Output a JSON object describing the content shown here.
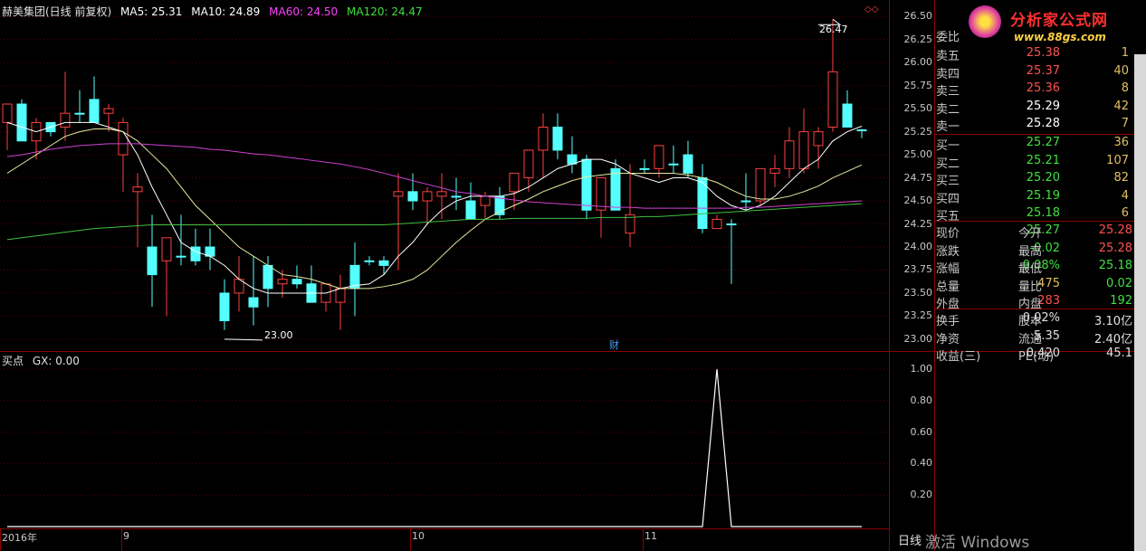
{
  "header": {
    "stock": "赫美集团(日线 前复权)",
    "ma5": "MA5: 25.31",
    "ma10": "MA10: 24.89",
    "ma60": "MA60: 24.50",
    "ma120": "MA120: 24.47"
  },
  "indicator": {
    "title": "买点",
    "gx": "GX: 0.00"
  },
  "logo": {
    "name": "分析家公式网",
    "url": "www.88gs.com"
  },
  "annotations": {
    "high": "26.47",
    "low": "23.00",
    "cai": "财"
  },
  "price_axis": [
    "26.50",
    "26.25",
    "26.00",
    "25.75",
    "25.50",
    "25.25",
    "25.00",
    "24.75",
    "24.50",
    "24.25",
    "24.00",
    "23.75",
    "23.50",
    "23.25",
    "23.00"
  ],
  "indicator_axis": [
    "1.00",
    "0.80",
    "0.60",
    "0.40",
    "0.20"
  ],
  "time_axis": [
    "2016年",
    "9",
    "10",
    "11"
  ],
  "bottom_right": {
    "period": "日线",
    "watermark": "激活 Windows"
  },
  "quote": {
    "weibi": "委比",
    "sells": [
      {
        "label": "卖五",
        "price": "25.38",
        "vol": "1"
      },
      {
        "label": "卖四",
        "price": "25.37",
        "vol": "40"
      },
      {
        "label": "卖三",
        "price": "25.36",
        "vol": "8"
      },
      {
        "label": "卖二",
        "price": "25.29",
        "vol": "42"
      },
      {
        "label": "卖一",
        "price": "25.28",
        "vol": "7"
      }
    ],
    "buys": [
      {
        "label": "买一",
        "price": "25.27",
        "vol": "36"
      },
      {
        "label": "买二",
        "price": "25.21",
        "vol": "107"
      },
      {
        "label": "买三",
        "price": "25.20",
        "vol": "82"
      },
      {
        "label": "买四",
        "price": "25.19",
        "vol": "4"
      },
      {
        "label": "买五",
        "price": "25.18",
        "vol": "6"
      }
    ],
    "stats": [
      {
        "l1": "现价",
        "v1": "25.27",
        "l2": "今开",
        "v2": "25.28"
      },
      {
        "l1": "涨跌",
        "v1": "-0.02",
        "l2": "最高",
        "v2": "25.28"
      },
      {
        "l1": "涨幅",
        "v1": "-0.08%",
        "l2": "最低",
        "v2": "25.18"
      },
      {
        "l1": "总量",
        "v1": "475",
        "l2": "量比",
        "v2": "0.02"
      },
      {
        "l1": "外盘",
        "v1": "283",
        "l2": "内盘",
        "v2": "192"
      }
    ],
    "fin": [
      {
        "l1": "换手",
        "v1": "0.02%",
        "l2": "股本",
        "v2": "3.10亿"
      },
      {
        "l1": "净资",
        "v1": "5.35",
        "l2": "流通",
        "v2": "2.40亿"
      },
      {
        "l1": "收益(三)",
        "v1": "0.420",
        "l2": "PE(动)",
        "v2": "45.1"
      }
    ]
  },
  "chart_data": {
    "type": "candlestick",
    "candles": [
      [
        25.35,
        25.55,
        25.05,
        25.55
      ],
      [
        25.55,
        25.6,
        25.15,
        25.15
      ],
      [
        25.15,
        25.4,
        24.95,
        25.35
      ],
      [
        25.35,
        25.3,
        25.2,
        25.25
      ],
      [
        25.3,
        25.9,
        25.15,
        25.45
      ],
      [
        25.45,
        25.7,
        25.35,
        25.45
      ],
      [
        25.6,
        25.85,
        25.35,
        25.35
      ],
      [
        25.45,
        25.55,
        25.25,
        25.5
      ],
      [
        25.0,
        25.4,
        24.6,
        25.35
      ],
      [
        24.6,
        24.8,
        24.0,
        24.65
      ],
      [
        24.0,
        24.35,
        23.35,
        23.7
      ],
      [
        23.85,
        24.1,
        23.25,
        24.1
      ],
      [
        23.9,
        24.35,
        23.8,
        23.9
      ],
      [
        24.0,
        24.2,
        23.8,
        23.85
      ],
      [
        24.0,
        24.2,
        23.75,
        23.9
      ],
      [
        23.5,
        23.65,
        23.1,
        23.2
      ],
      [
        23.5,
        23.9,
        23.3,
        23.65
      ],
      [
        23.45,
        23.9,
        23.15,
        23.35
      ],
      [
        23.8,
        23.9,
        23.35,
        23.55
      ],
      [
        23.6,
        23.75,
        23.45,
        23.65
      ],
      [
        23.65,
        23.8,
        23.55,
        23.6
      ],
      [
        23.6,
        23.8,
        23.5,
        23.4
      ],
      [
        23.4,
        23.5,
        23.3,
        23.6
      ],
      [
        23.4,
        23.7,
        23.1,
        23.55
      ],
      [
        23.8,
        24.05,
        23.25,
        23.55
      ],
      [
        23.85,
        23.9,
        23.8,
        23.85
      ],
      [
        23.85,
        23.9,
        23.7,
        23.8
      ],
      [
        24.55,
        24.8,
        23.75,
        24.6
      ],
      [
        24.6,
        24.8,
        24.4,
        24.5
      ],
      [
        24.5,
        24.65,
        24.25,
        24.6
      ],
      [
        24.55,
        24.8,
        24.3,
        24.6
      ],
      [
        24.55,
        24.75,
        24.4,
        24.55
      ],
      [
        24.5,
        24.7,
        24.3,
        24.3
      ],
      [
        24.45,
        24.6,
        24.3,
        24.55
      ],
      [
        24.55,
        24.65,
        24.3,
        24.35
      ],
      [
        24.6,
        24.7,
        24.4,
        24.8
      ],
      [
        24.75,
        25.05,
        24.6,
        25.05
      ],
      [
        25.05,
        25.45,
        24.75,
        25.3
      ],
      [
        25.3,
        25.45,
        24.95,
        25.05
      ],
      [
        25.0,
        25.2,
        24.8,
        24.9
      ],
      [
        24.95,
        25.0,
        24.3,
        24.4
      ],
      [
        24.4,
        24.65,
        24.1,
        24.75
      ],
      [
        24.85,
        24.95,
        24.4,
        24.4
      ],
      [
        24.15,
        24.9,
        24.0,
        24.35
      ],
      [
        24.85,
        24.95,
        24.8,
        24.85
      ],
      [
        24.85,
        25.05,
        24.75,
        25.1
      ],
      [
        24.9,
        25.1,
        24.8,
        24.9
      ],
      [
        25.0,
        25.15,
        24.75,
        24.8
      ],
      [
        24.75,
        24.9,
        24.15,
        24.2
      ],
      [
        24.2,
        24.35,
        24.2,
        24.3
      ],
      [
        24.25,
        24.3,
        23.6,
        24.25
      ],
      [
        24.5,
        24.8,
        24.4,
        24.5
      ],
      [
        24.5,
        24.85,
        24.45,
        24.85
      ],
      [
        24.8,
        25.0,
        24.65,
        24.85
      ],
      [
        24.85,
        25.3,
        24.75,
        25.15
      ],
      [
        24.85,
        25.5,
        24.8,
        25.25
      ],
      [
        25.1,
        25.3,
        24.85,
        25.25
      ],
      [
        25.3,
        26.47,
        25.25,
        25.9
      ],
      [
        25.55,
        25.7,
        25.3,
        25.3
      ],
      [
        25.27,
        25.28,
        25.18,
        25.27
      ]
    ],
    "ma5": [
      25.35,
      25.3,
      25.25,
      25.3,
      25.35,
      25.35,
      25.35,
      25.3,
      25.25,
      25.0,
      24.65,
      24.35,
      24.05,
      23.95,
      23.9,
      23.8,
      23.65,
      23.55,
      23.5,
      23.5,
      23.5,
      23.5,
      23.5,
      23.55,
      23.58,
      23.6,
      23.7,
      23.9,
      24.05,
      24.25,
      24.4,
      24.5,
      24.55,
      24.55,
      24.55,
      24.58,
      24.65,
      24.75,
      24.85,
      24.9,
      24.95,
      24.95,
      24.9,
      24.8,
      24.75,
      24.7,
      24.75,
      24.75,
      24.7,
      24.55,
      24.45,
      24.4,
      24.45,
      24.55,
      24.7,
      24.85,
      24.95,
      25.15,
      25.25,
      25.31
    ],
    "ma10": [
      24.8,
      24.9,
      25.0,
      25.1,
      25.2,
      25.25,
      25.28,
      25.28,
      25.25,
      25.15,
      25.0,
      24.85,
      24.65,
      24.45,
      24.3,
      24.15,
      24.0,
      23.9,
      23.8,
      23.7,
      23.68,
      23.65,
      23.6,
      23.55,
      23.55,
      23.55,
      23.57,
      23.6,
      23.65,
      23.75,
      23.9,
      24.05,
      24.18,
      24.3,
      24.38,
      24.45,
      24.52,
      24.6,
      24.66,
      24.72,
      24.76,
      24.78,
      24.8,
      24.8,
      24.8,
      24.8,
      24.8,
      24.78,
      24.75,
      24.7,
      24.62,
      24.55,
      24.52,
      24.52,
      24.55,
      24.6,
      24.66,
      24.75,
      24.82,
      24.89
    ],
    "ma60": [
      24.98,
      25.0,
      25.03,
      25.06,
      25.08,
      25.1,
      25.11,
      25.12,
      25.12,
      25.12,
      25.11,
      25.1,
      25.09,
      25.08,
      25.06,
      25.05,
      25.03,
      25.01,
      25.0,
      24.98,
      24.96,
      24.94,
      24.92,
      24.9,
      24.87,
      24.84,
      24.8,
      24.76,
      24.72,
      24.68,
      24.64,
      24.6,
      24.58,
      24.55,
      24.53,
      24.51,
      24.49,
      24.48,
      24.47,
      24.46,
      24.45,
      24.44,
      24.43,
      24.43,
      24.42,
      24.42,
      24.42,
      24.42,
      24.42,
      24.42,
      24.42,
      24.43,
      24.43,
      24.44,
      24.45,
      24.46,
      24.47,
      24.48,
      24.49,
      24.5
    ],
    "ma120": [
      24.08,
      24.1,
      24.12,
      24.14,
      24.16,
      24.18,
      24.2,
      24.21,
      24.22,
      24.23,
      24.24,
      24.24,
      24.24,
      24.24,
      24.24,
      24.24,
      24.24,
      24.24,
      24.24,
      24.24,
      24.24,
      24.24,
      24.24,
      24.24,
      24.24,
      24.24,
      24.24,
      24.25,
      24.26,
      24.27,
      24.28,
      24.29,
      24.3,
      24.3,
      24.3,
      24.31,
      24.31,
      24.31,
      24.31,
      24.31,
      24.31,
      24.32,
      24.32,
      24.32,
      24.33,
      24.33,
      24.34,
      24.35,
      24.36,
      24.37,
      24.38,
      24.39,
      24.4,
      24.41,
      24.42,
      24.43,
      24.44,
      24.45,
      24.46,
      24.47
    ],
    "indicator": [
      0,
      0,
      0,
      0,
      0,
      0,
      0,
      0,
      0,
      0,
      0,
      0,
      0,
      0,
      0,
      0,
      0,
      0,
      0,
      0,
      0,
      0,
      0,
      0,
      0,
      0,
      0,
      0,
      0,
      0,
      0,
      0,
      0,
      0,
      0,
      0,
      0,
      0,
      0,
      0,
      0,
      0,
      0,
      0,
      0,
      0,
      0,
      0,
      0,
      1,
      0,
      0,
      0,
      0,
      0,
      0,
      0,
      0,
      0,
      0
    ],
    "ylim": [
      22.95,
      26.6
    ],
    "ind_ylim": [
      0,
      1.0
    ]
  }
}
